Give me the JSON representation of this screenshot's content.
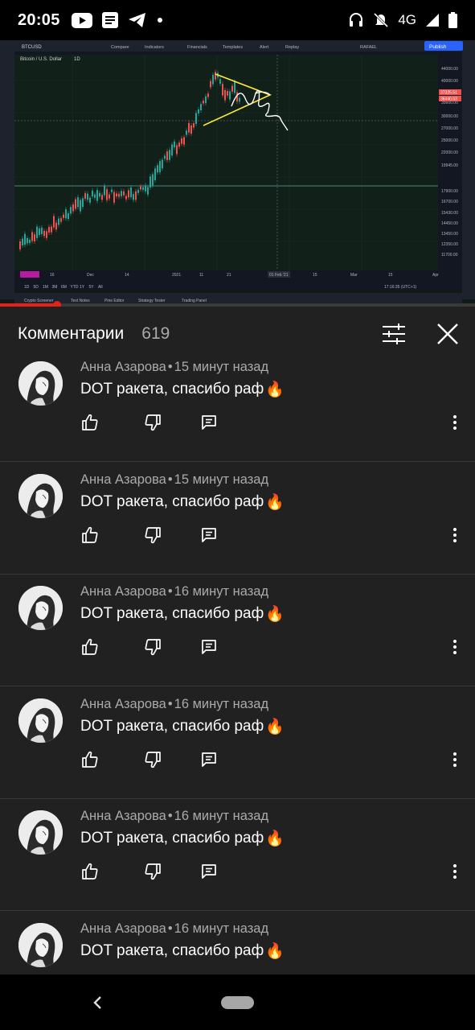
{
  "status_bar": {
    "time": "20:05",
    "network": "4G",
    "icons": [
      "youtube-icon",
      "news-icon",
      "telegram-icon",
      "dot-icon",
      "headset-icon",
      "mute-icon",
      "signal-icon",
      "battery-icon"
    ]
  },
  "video": {
    "symbol": "BTCUSD",
    "pair_title": "Bitcoin / U.S. Dollar",
    "interval": "1D",
    "toolbar": [
      "Compare",
      "Indicators",
      "Financials",
      "Templates",
      "Alert",
      "Replay"
    ],
    "user": "RAFAEL",
    "publish_label": "Publish",
    "price_ticks": [
      "44000.00",
      "40000.00",
      "35600.00",
      "30000.00",
      "27000.00",
      "25000.00",
      "22000.00",
      "19945.00",
      "17900.00",
      "16700.00",
      "15430.00",
      "14450.00",
      "13450.00",
      "12350.00",
      "11700.00"
    ],
    "price_current": "37325.51",
    "price_sub": "36440.63",
    "time_ticks": [
      "16",
      "Dec",
      "14",
      "2021",
      "11",
      "21",
      "01 Feb '21",
      "15",
      "Mar",
      "15",
      "Apr"
    ],
    "ranges": [
      "1D",
      "5D",
      "1M",
      "3M",
      "6M",
      "YTD",
      "1Y",
      "5Y",
      "All"
    ],
    "clock": "17:16:35 (UTC+1)",
    "bottom_tabs": [
      "Crypto Screener",
      "Text Notes",
      "Pine Editor",
      "Strategy Tester",
      "Trading Panel"
    ],
    "progress_fraction": 0.12
  },
  "comments_header": {
    "title": "Комментарии",
    "count": "619"
  },
  "comments": [
    {
      "author": "Анна Азарова",
      "time": "15 минут назад",
      "text": "DOT ракета, спасибо раф",
      "emoji": "🔥"
    },
    {
      "author": "Анна Азарова",
      "time": "15 минут назад",
      "text": "DOT ракета, спасибо раф",
      "emoji": "🔥"
    },
    {
      "author": "Анна Азарова",
      "time": "16 минут назад",
      "text": "DOT ракета, спасибо раф",
      "emoji": "🔥"
    },
    {
      "author": "Анна Азарова",
      "time": "16 минут назад",
      "text": "DOT ракета, спасибо раф",
      "emoji": "🔥"
    },
    {
      "author": "Анна Азарова",
      "time": "16 минут назад",
      "text": "DOT ракета, спасибо раф",
      "emoji": "🔥"
    },
    {
      "author": "Анна Азарова",
      "time": "16 минут назад",
      "text": "DOT ракета, спасибо раф",
      "emoji": "🔥"
    }
  ],
  "meta_separator": "•",
  "colors": {
    "accent": "#e62117",
    "panel": "#212121",
    "chart_up": "#26a69a",
    "chart_down": "#ef5350",
    "drawing": "#ffeb3b"
  }
}
